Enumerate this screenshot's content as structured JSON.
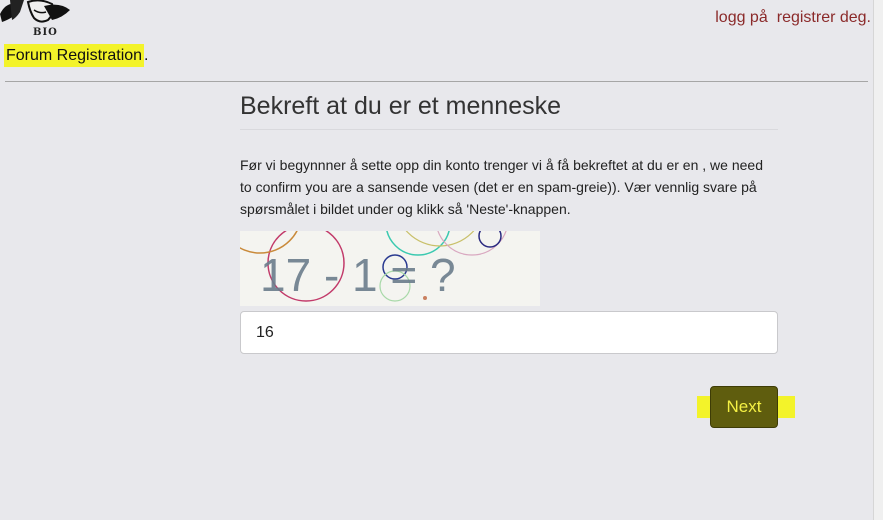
{
  "header": {
    "logo_text": "BIO",
    "login_link": "logg på",
    "register_link": "registrer deg.",
    "forum_registration": "Forum Registration",
    "forum_registration_suffix": "."
  },
  "main": {
    "title": "Bekreft at du er et menneske",
    "description": "Før vi begynnner å sette opp din konto trenger vi å få bekreftet at du er en , we need to confirm you are a sansende vesen (det er en spam-greie)). Vær vennlig svare på spørsmålet i bildet under og klikk så 'Neste'-knappen.",
    "captcha_text": "17 - 1 = ?",
    "answer_value": "16",
    "next_button": "Next"
  },
  "colors": {
    "link": "#8b2a2a",
    "highlight": "#f3f32a",
    "button_bg": "#5f5d0e",
    "button_text": "#f4f044"
  }
}
